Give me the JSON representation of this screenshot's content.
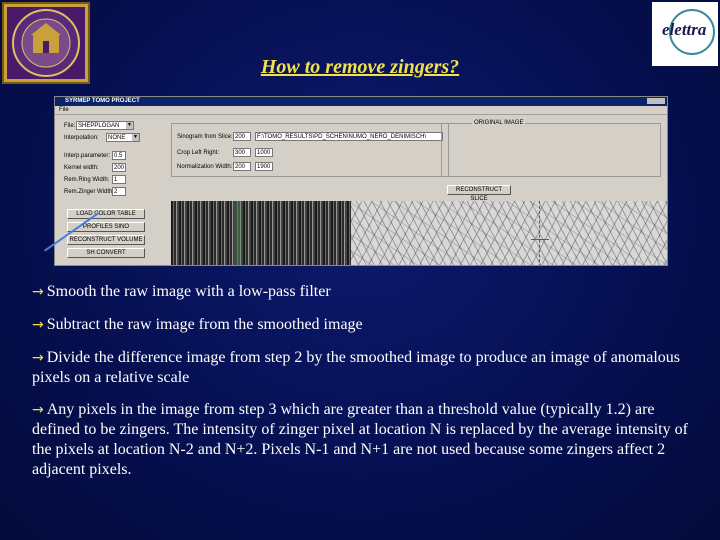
{
  "slide": {
    "title": "How to remove zingers?"
  },
  "logos": {
    "right_text": "elettra"
  },
  "screenshot": {
    "window_title": "SYRMEP TOMO PROJECT",
    "menu": [
      "File"
    ],
    "left_panel": {
      "file_label": "File:",
      "file_value": "SHEPPLOGAN",
      "interp_label": "Interpolation:",
      "interp_value": "NONE",
      "rows": [
        {
          "label": "Interp.parameter:",
          "value": "0.5"
        },
        {
          "label": "Kernel width:",
          "value": "200"
        },
        {
          "label": "Rem.Ring Width:",
          "value": "1"
        },
        {
          "label": "Rem.Zinger Width:",
          "value": "2"
        }
      ],
      "buttons": [
        "LOAD COLOR TABLE",
        "PROFILES SINO",
        "RECONSTRUCT VOLUME",
        "SH CONVERT"
      ]
    },
    "center_panel": {
      "rows": [
        {
          "label": "Sinogram from Slice:",
          "value": "200"
        },
        {
          "label": "Crop Left Right:",
          "value": "300"
        },
        {
          "label": "Normalization Width:",
          "value": "200"
        }
      ],
      "path": "F:\\TOMO_RESULTS\\PD_SCHEN\\NUMO_NERO_DENIMISCH\\",
      "right_values": [
        "1000",
        "1900"
      ]
    },
    "original_frame_caption": "ORIGINAL IMAGE",
    "reconstruct_button": "RECONSTRUCT SLICE"
  },
  "bullets": [
    {
      "arrow": "→",
      "text": "Smooth the raw image with a low-pass filter"
    },
    {
      "arrow": "→",
      "text": "Subtract the raw image from the smoothed image"
    },
    {
      "arrow": "→",
      "text": "Divide the difference image from step 2 by the smoothed image to produce an image of anomalous pixels on a relative scale"
    },
    {
      "arrow": "→",
      "text": "Any pixels in the image from step 3 which are greater than a threshold value (typically 1.2) are defined to be zingers. The intensity of zinger pixel at location N is replaced by the average intensity of the pixels at location N-2 and N+2.  Pixels N-1 and N+1 are not used because some zingers affect 2 adjacent pixels."
    }
  ],
  "colors": {
    "background": "#061052",
    "title": "#f2e04c",
    "bullet_arrow": "#f2e04c",
    "text": "#ffffff"
  }
}
